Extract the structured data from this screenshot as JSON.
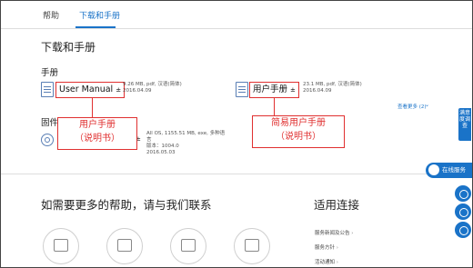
{
  "tabs": [
    "帮助",
    "下载和手册"
  ],
  "page_title": "下载和手册",
  "manual_section": "手册",
  "manuals": [
    {
      "name": "User Manual",
      "dl": "±",
      "meta1": "9.26 MB, pdf, 汉语(简体)",
      "meta2": "2016.04.09"
    },
    {
      "name": "用户手册",
      "dl": "±",
      "meta1": "23.1 MB, pdf, 汉语(简体)",
      "meta2": "2016.04.09"
    }
  ],
  "see_more": "查看更多 (2)",
  "see_more_chevron": "⌄",
  "firmware_section": "固件",
  "firmware": {
    "dl": "±",
    "meta1": "All OS, 1155.51 MB, exe, 多种语",
    "meta2": "言",
    "meta3": "版本：1004.0",
    "meta4": "2016.05.03"
  },
  "callouts": {
    "c1_line1": "用户手册",
    "c1_line2": "（说明书）",
    "c2_line1": "简易用户手册",
    "c2_line2": "（说明书）"
  },
  "help_title": "如需要更多的帮助，请与我们联系",
  "links_title": "适用连接",
  "links": [
    "服务新闻及公告",
    "服务方针",
    "活动通知"
  ],
  "link_arrow": "›",
  "side": {
    "survey": "满意度调查",
    "online": "在线服务"
  },
  "colors": {
    "accent": "#1a73c8",
    "annotation": "#e03030"
  }
}
